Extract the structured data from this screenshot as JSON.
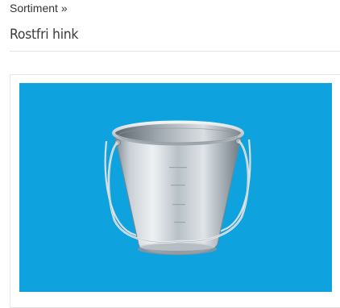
{
  "breadcrumb": {
    "parent_label": "Sortiment",
    "separator": "»"
  },
  "page": {
    "title": "Rostfri hink"
  },
  "product_image": {
    "icon": "steel-bucket-icon",
    "background_color": "#0ea3df"
  }
}
